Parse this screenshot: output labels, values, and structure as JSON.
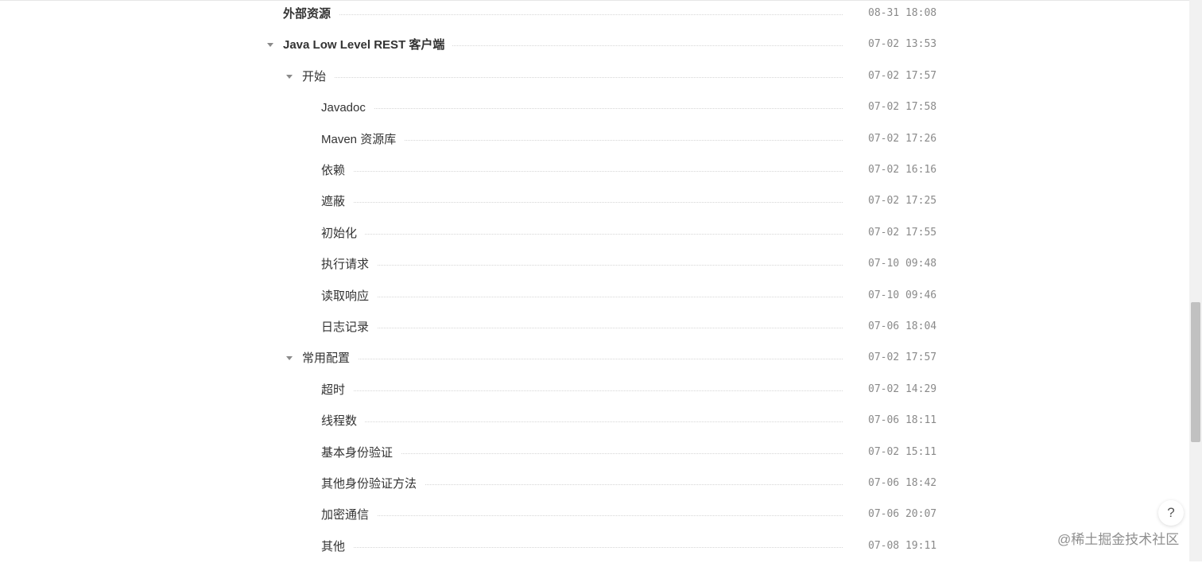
{
  "toc": {
    "items": [
      {
        "title": "外部资源",
        "time": "08-31 18:08",
        "level": 0,
        "bold": true,
        "expanded": false
      },
      {
        "title": "Java Low Level REST 客户端",
        "time": "07-02 13:53",
        "level": 0,
        "bold": true,
        "expanded": true
      },
      {
        "title": "开始",
        "time": "07-02 17:57",
        "level": 1,
        "bold": false,
        "expanded": true
      },
      {
        "title": "Javadoc",
        "time": "07-02 17:58",
        "level": 2,
        "bold": false,
        "expanded": false
      },
      {
        "title": "Maven 资源库",
        "time": "07-02 17:26",
        "level": 2,
        "bold": false,
        "expanded": false
      },
      {
        "title": "依赖",
        "time": "07-02 16:16",
        "level": 2,
        "bold": false,
        "expanded": false
      },
      {
        "title": "遮蔽",
        "time": "07-02 17:25",
        "level": 2,
        "bold": false,
        "expanded": false
      },
      {
        "title": "初始化",
        "time": "07-02 17:55",
        "level": 2,
        "bold": false,
        "expanded": false
      },
      {
        "title": "执行请求",
        "time": "07-10 09:48",
        "level": 2,
        "bold": false,
        "expanded": false
      },
      {
        "title": "读取响应",
        "time": "07-10 09:46",
        "level": 2,
        "bold": false,
        "expanded": false
      },
      {
        "title": "日志记录",
        "time": "07-06 18:04",
        "level": 2,
        "bold": false,
        "expanded": false
      },
      {
        "title": "常用配置",
        "time": "07-02 17:57",
        "level": 1,
        "bold": false,
        "expanded": true
      },
      {
        "title": "超时",
        "time": "07-02 14:29",
        "level": 2,
        "bold": false,
        "expanded": false
      },
      {
        "title": "线程数",
        "time": "07-06 18:11",
        "level": 2,
        "bold": false,
        "expanded": false
      },
      {
        "title": "基本身份验证",
        "time": "07-02 15:11",
        "level": 2,
        "bold": false,
        "expanded": false
      },
      {
        "title": "其他身份验证方法",
        "time": "07-06 18:42",
        "level": 2,
        "bold": false,
        "expanded": false
      },
      {
        "title": "加密通信",
        "time": "07-06 20:07",
        "level": 2,
        "bold": false,
        "expanded": false
      },
      {
        "title": "其他",
        "time": "07-08 19:11",
        "level": 2,
        "bold": false,
        "expanded": false
      }
    ]
  },
  "help": {
    "label": "?"
  },
  "watermark": {
    "text": "@稀土掘金技术社区"
  }
}
